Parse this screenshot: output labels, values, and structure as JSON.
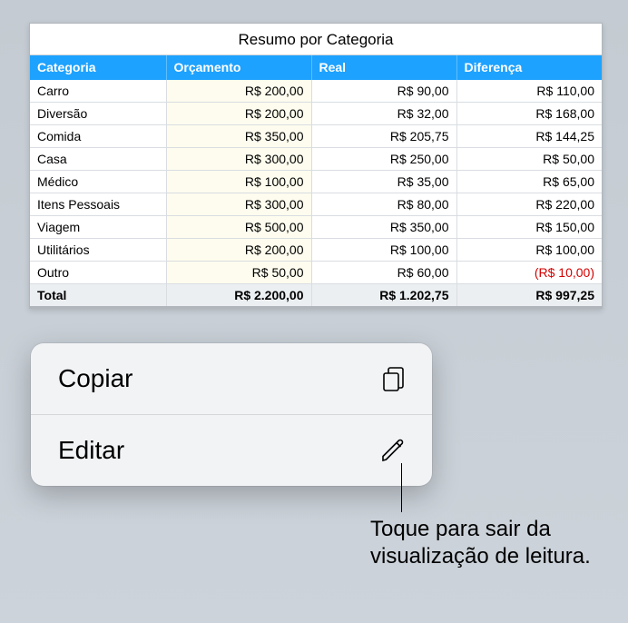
{
  "table": {
    "title": "Resumo por Categoria",
    "headers": [
      "Categoria",
      "Orçamento",
      "Real",
      "Diferença"
    ],
    "rows": [
      {
        "cat": "Carro",
        "budget": "R$ 200,00",
        "real": "R$ 90,00",
        "diff": "R$ 110,00",
        "neg": false
      },
      {
        "cat": "Diversão",
        "budget": "R$ 200,00",
        "real": "R$ 32,00",
        "diff": "R$ 168,00",
        "neg": false
      },
      {
        "cat": "Comida",
        "budget": "R$ 350,00",
        "real": "R$ 205,75",
        "diff": "R$ 144,25",
        "neg": false
      },
      {
        "cat": "Casa",
        "budget": "R$ 300,00",
        "real": "R$ 250,00",
        "diff": "R$ 50,00",
        "neg": false
      },
      {
        "cat": "Médico",
        "budget": "R$ 100,00",
        "real": "R$ 35,00",
        "diff": "R$ 65,00",
        "neg": false
      },
      {
        "cat": "Itens Pessoais",
        "budget": "R$ 300,00",
        "real": "R$ 80,00",
        "diff": "R$ 220,00",
        "neg": false
      },
      {
        "cat": "Viagem",
        "budget": "R$ 500,00",
        "real": "R$ 350,00",
        "diff": "R$ 150,00",
        "neg": false
      },
      {
        "cat": "Utilitários",
        "budget": "R$ 200,00",
        "real": "R$ 100,00",
        "diff": "R$ 100,00",
        "neg": false
      },
      {
        "cat": "Outro",
        "budget": "R$ 50,00",
        "real": "R$ 60,00",
        "diff": "(R$ 10,00)",
        "neg": true
      }
    ],
    "total": {
      "label": "Total",
      "budget": "R$ 2.200,00",
      "real": "R$ 1.202,75",
      "diff": "R$ 997,25"
    }
  },
  "menu": {
    "copy_label": "Copiar",
    "edit_label": "Editar"
  },
  "callout": "Toque para sair da visualização de leitura."
}
